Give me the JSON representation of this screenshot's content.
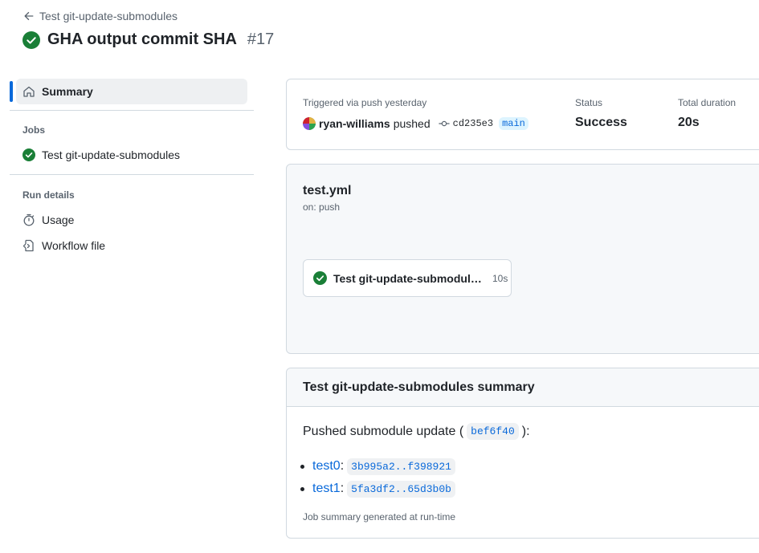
{
  "header": {
    "back_label": "Test git-update-submodules",
    "title": "GHA output commit SHA",
    "run_number": "#17"
  },
  "sidebar": {
    "summary_label": "Summary",
    "jobs_heading": "Jobs",
    "jobs": [
      {
        "label": "Test git-update-submodules",
        "status": "success"
      }
    ],
    "run_details_heading": "Run details",
    "usage_label": "Usage",
    "workflow_file_label": "Workflow file"
  },
  "trigger": {
    "triggered_text": "Triggered via push yesterday",
    "actor": "ryan-williams",
    "action": "pushed",
    "commit": "cd235e3",
    "branch": "main",
    "status_label": "Status",
    "status_value": "Success",
    "duration_label": "Total duration",
    "duration_value": "20s"
  },
  "workflow": {
    "file": "test.yml",
    "trigger": "on: push",
    "job_name": "Test git-update-submodules",
    "job_duration": "10s"
  },
  "job_summary": {
    "title": "Test git-update-submodules summary",
    "pushed_prefix": "Pushed submodule update (",
    "pushed_sha": "bef6f40",
    "pushed_suffix": "):",
    "items": [
      {
        "name": "test0",
        "range": "3b995a2..f398921"
      },
      {
        "name": "test1",
        "range": "5fa3df2..65d3b0b"
      }
    ],
    "footer": "Job summary generated at run-time"
  },
  "colors": {
    "success": "#1a7f37",
    "accent": "#0969da",
    "border": "#d1d9e0"
  }
}
